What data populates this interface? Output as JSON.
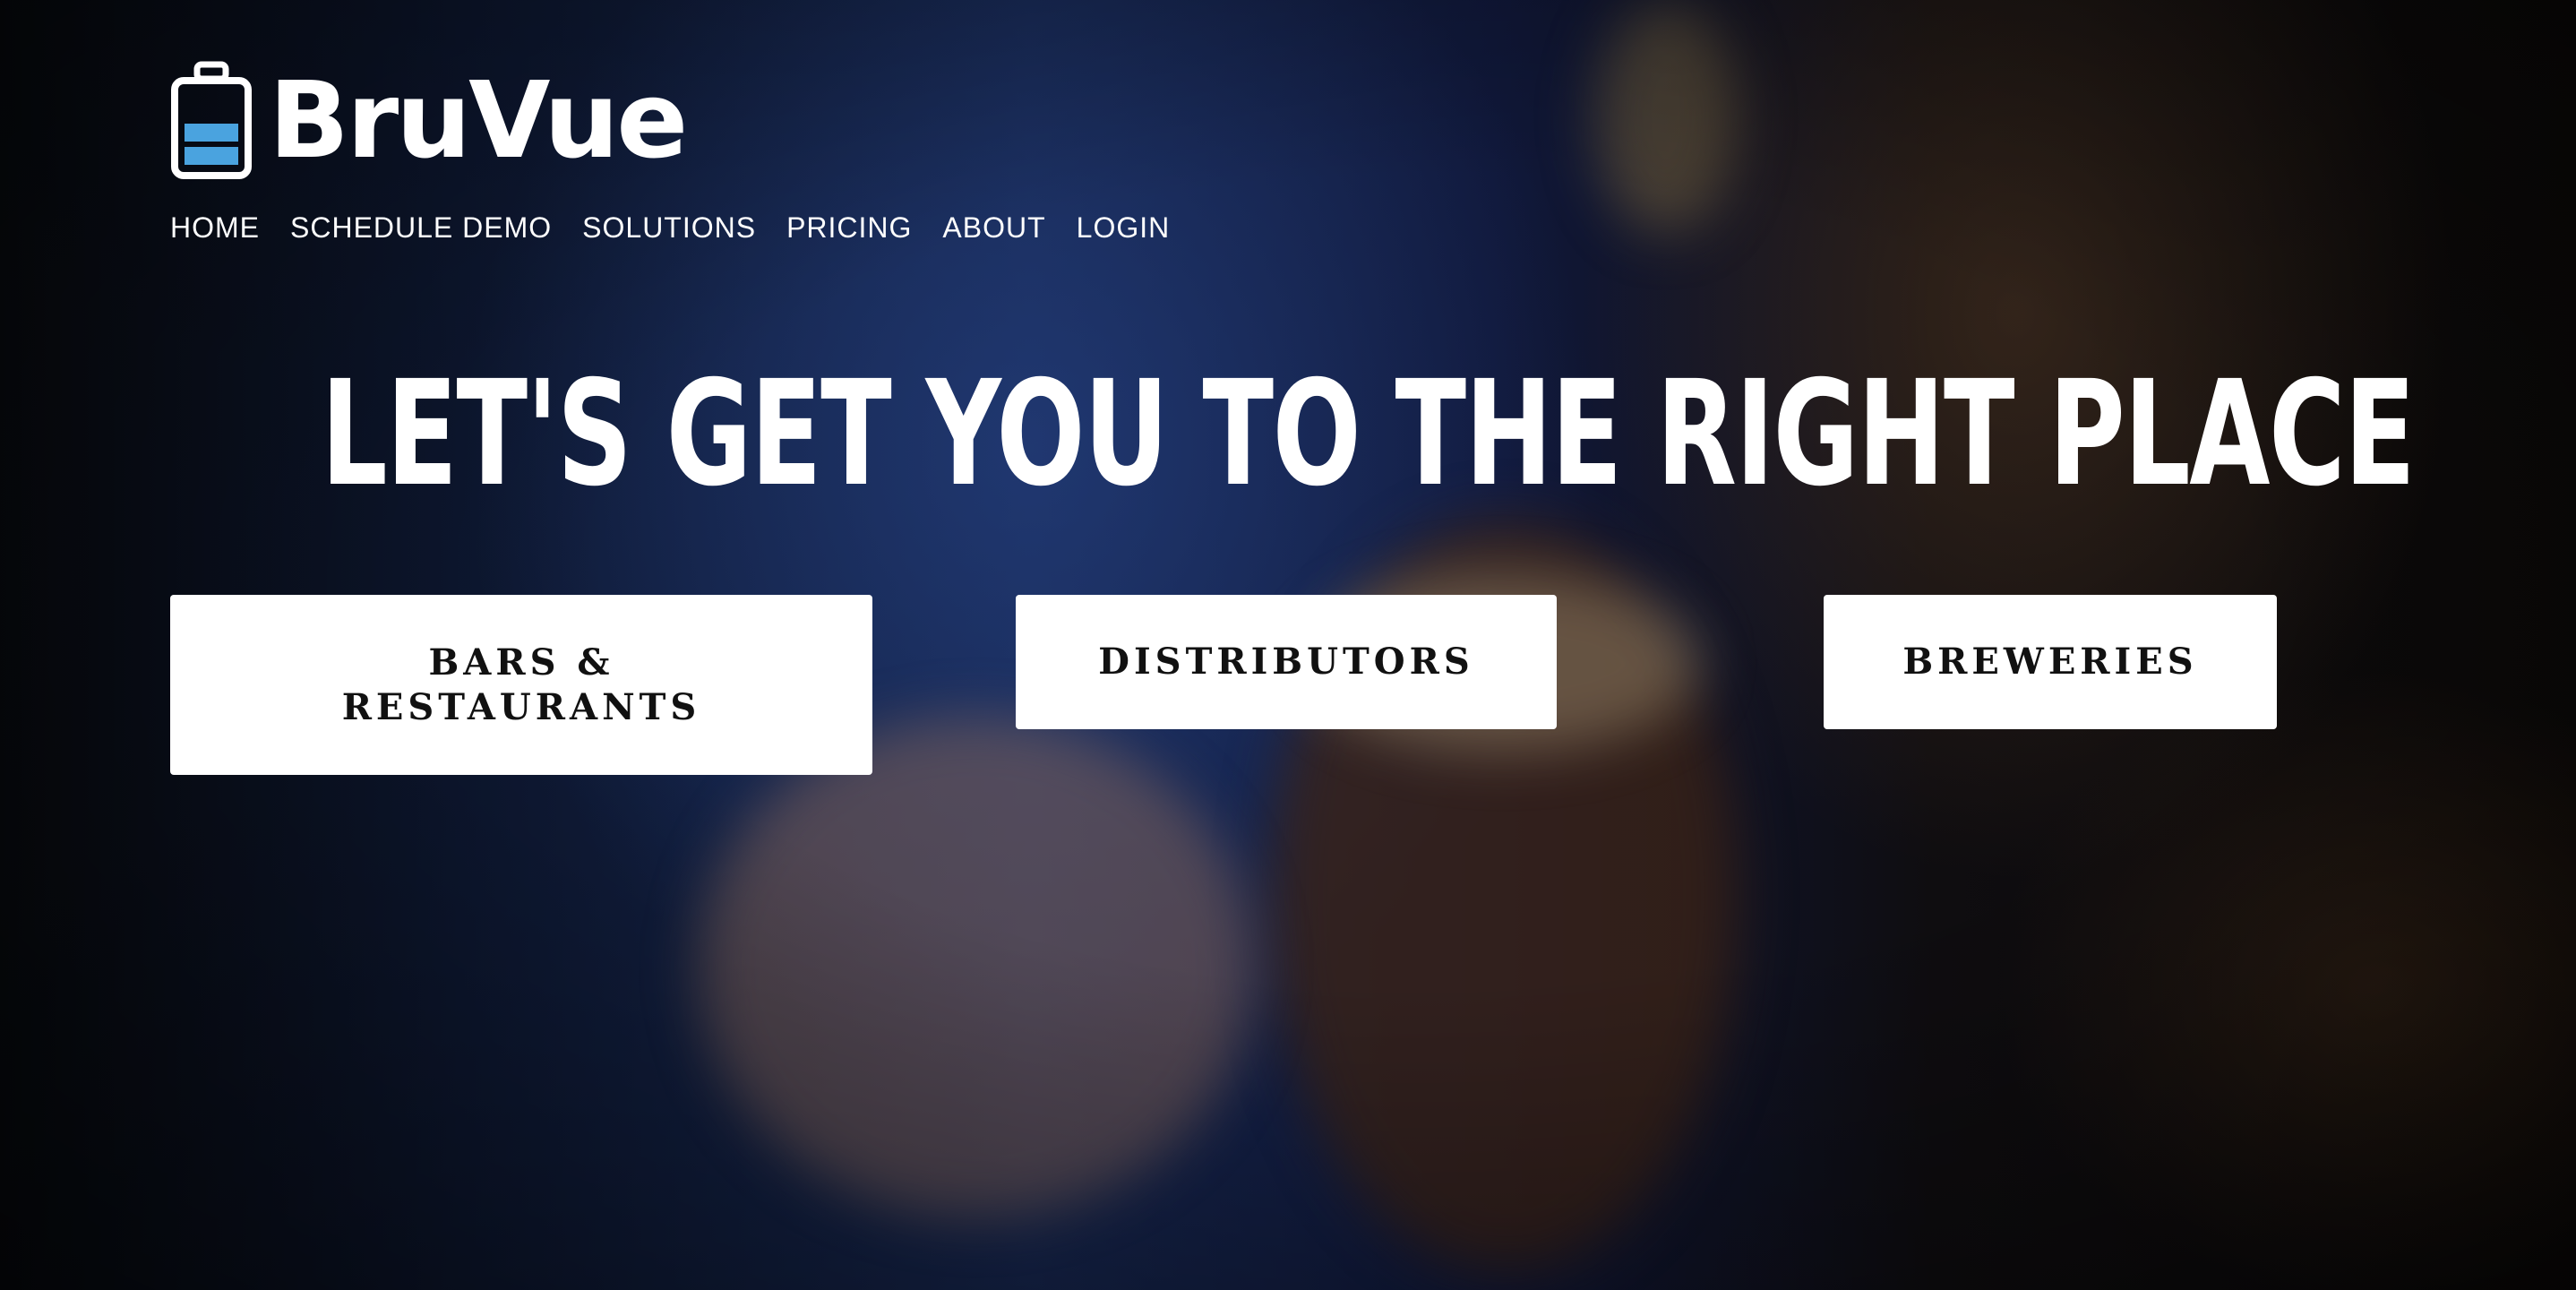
{
  "brand": {
    "name": "BruVue",
    "logo_icon": "keg-icon",
    "accent_color": "#4aa3df"
  },
  "nav": {
    "items": [
      {
        "label": "HOME"
      },
      {
        "label": "SCHEDULE DEMO"
      },
      {
        "label": "SOLUTIONS"
      },
      {
        "label": "PRICING"
      },
      {
        "label": "ABOUT"
      },
      {
        "label": "LOGIN"
      }
    ]
  },
  "hero": {
    "headline": "LET'S GET YOU TO THE RIGHT PLACE",
    "buttons": [
      {
        "label": "BARS & RESTAURANTS"
      },
      {
        "label": "DISTRIBUTORS"
      },
      {
        "label": "BREWERIES"
      }
    ]
  }
}
